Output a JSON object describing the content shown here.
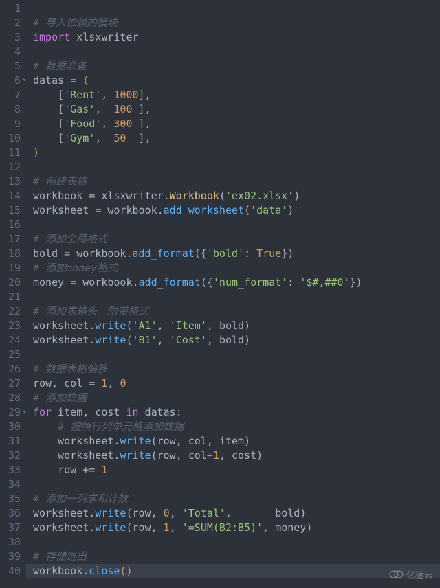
{
  "lines": [
    {
      "n": 1,
      "fold": "",
      "seg": []
    },
    {
      "n": 2,
      "fold": "",
      "seg": [
        [
          "cmt",
          "# 导入依赖的模块"
        ]
      ]
    },
    {
      "n": 3,
      "fold": "",
      "seg": [
        [
          "kw",
          "import"
        ],
        [
          "id",
          " xlsxwriter"
        ]
      ]
    },
    {
      "n": 4,
      "fold": "",
      "seg": []
    },
    {
      "n": 5,
      "fold": "",
      "seg": [
        [
          "cmt",
          "# 数据准备"
        ]
      ]
    },
    {
      "n": 6,
      "fold": "▾",
      "seg": [
        [
          "id",
          "datas "
        ],
        [
          "op",
          "= "
        ],
        [
          "par",
          "("
        ]
      ]
    },
    {
      "n": 7,
      "fold": "",
      "seg": [
        [
          "id",
          "    "
        ],
        [
          "pun",
          "["
        ],
        [
          "str",
          "'Rent'"
        ],
        [
          "pun",
          ", "
        ],
        [
          "num",
          "1000"
        ],
        [
          "pun",
          "],"
        ]
      ]
    },
    {
      "n": 8,
      "fold": "",
      "seg": [
        [
          "id",
          "    "
        ],
        [
          "pun",
          "["
        ],
        [
          "str",
          "'Gas'"
        ],
        [
          "pun",
          ",  "
        ],
        [
          "num",
          "100"
        ],
        [
          "pun",
          " ],"
        ]
      ]
    },
    {
      "n": 9,
      "fold": "",
      "seg": [
        [
          "id",
          "    "
        ],
        [
          "pun",
          "["
        ],
        [
          "str",
          "'Food'"
        ],
        [
          "pun",
          ", "
        ],
        [
          "num",
          "300"
        ],
        [
          "pun",
          " ],"
        ]
      ]
    },
    {
      "n": 10,
      "fold": "",
      "seg": [
        [
          "id",
          "    "
        ],
        [
          "pun",
          "["
        ],
        [
          "str",
          "'Gym'"
        ],
        [
          "pun",
          ",  "
        ],
        [
          "num",
          "50"
        ],
        [
          "pun",
          "  ],"
        ]
      ]
    },
    {
      "n": 11,
      "fold": "",
      "seg": [
        [
          "par",
          ")"
        ]
      ]
    },
    {
      "n": 12,
      "fold": "",
      "seg": []
    },
    {
      "n": 13,
      "fold": "",
      "seg": [
        [
          "cmt",
          "# 创建表格"
        ]
      ]
    },
    {
      "n": 14,
      "fold": "",
      "seg": [
        [
          "id",
          "workbook "
        ],
        [
          "op",
          "= "
        ],
        [
          "id",
          "xlsxwriter"
        ],
        [
          "pun",
          "."
        ],
        [
          "cls",
          "Workbook"
        ],
        [
          "pun",
          "("
        ],
        [
          "str",
          "'ex02.xlsx'"
        ],
        [
          "pun",
          ")"
        ]
      ]
    },
    {
      "n": 15,
      "fold": "",
      "seg": [
        [
          "id",
          "worksheet "
        ],
        [
          "op",
          "= "
        ],
        [
          "id",
          "workbook"
        ],
        [
          "pun",
          "."
        ],
        [
          "fn",
          "add_worksheet"
        ],
        [
          "pun",
          "("
        ],
        [
          "str",
          "'data'"
        ],
        [
          "pun",
          ")"
        ]
      ]
    },
    {
      "n": 16,
      "fold": "",
      "seg": []
    },
    {
      "n": 17,
      "fold": "",
      "seg": [
        [
          "cmt",
          "# 添加全局格式"
        ]
      ]
    },
    {
      "n": 18,
      "fold": "",
      "seg": [
        [
          "id",
          "bold "
        ],
        [
          "op",
          "= "
        ],
        [
          "id",
          "workbook"
        ],
        [
          "pun",
          "."
        ],
        [
          "fn",
          "add_format"
        ],
        [
          "pun",
          "({"
        ],
        [
          "str",
          "'bold'"
        ],
        [
          "pun",
          ": "
        ],
        [
          "const",
          "True"
        ],
        [
          "pun",
          "})"
        ]
      ]
    },
    {
      "n": 19,
      "fold": "",
      "seg": [
        [
          "cmt",
          "# 添加money格式"
        ]
      ]
    },
    {
      "n": 20,
      "fold": "",
      "seg": [
        [
          "id",
          "money "
        ],
        [
          "op",
          "= "
        ],
        [
          "id",
          "workbook"
        ],
        [
          "pun",
          "."
        ],
        [
          "fn",
          "add_format"
        ],
        [
          "pun",
          "({"
        ],
        [
          "str",
          "'num_format'"
        ],
        [
          "pun",
          ": "
        ],
        [
          "str",
          "'$#,##0'"
        ],
        [
          "pun",
          "})"
        ]
      ]
    },
    {
      "n": 21,
      "fold": "",
      "seg": []
    },
    {
      "n": 22,
      "fold": "",
      "seg": [
        [
          "cmt",
          "# 添加表格头，附带格式"
        ]
      ]
    },
    {
      "n": 23,
      "fold": "",
      "seg": [
        [
          "id",
          "worksheet"
        ],
        [
          "pun",
          "."
        ],
        [
          "fn",
          "write"
        ],
        [
          "pun",
          "("
        ],
        [
          "str",
          "'A1'"
        ],
        [
          "pun",
          ", "
        ],
        [
          "str",
          "'Item'"
        ],
        [
          "pun",
          ", "
        ],
        [
          "id",
          "bold"
        ],
        [
          "pun",
          ")"
        ]
      ]
    },
    {
      "n": 24,
      "fold": "",
      "seg": [
        [
          "id",
          "worksheet"
        ],
        [
          "pun",
          "."
        ],
        [
          "fn",
          "write"
        ],
        [
          "pun",
          "("
        ],
        [
          "str",
          "'B1'"
        ],
        [
          "pun",
          ", "
        ],
        [
          "str",
          "'Cost'"
        ],
        [
          "pun",
          ", "
        ],
        [
          "id",
          "bold"
        ],
        [
          "pun",
          ")"
        ]
      ]
    },
    {
      "n": 25,
      "fold": "",
      "seg": []
    },
    {
      "n": 26,
      "fold": "",
      "seg": [
        [
          "cmt",
          "# 数据表格偏移"
        ]
      ]
    },
    {
      "n": 27,
      "fold": "",
      "seg": [
        [
          "id",
          "row"
        ],
        [
          "pun",
          ", "
        ],
        [
          "id",
          "col "
        ],
        [
          "op",
          "= "
        ],
        [
          "num",
          "1"
        ],
        [
          "pun",
          ", "
        ],
        [
          "num",
          "0"
        ]
      ]
    },
    {
      "n": 28,
      "fold": "",
      "seg": [
        [
          "cmt",
          "# 添加数据"
        ]
      ]
    },
    {
      "n": 29,
      "fold": "▾",
      "seg": [
        [
          "kw",
          "for"
        ],
        [
          "id",
          " item"
        ],
        [
          "pun",
          ", "
        ],
        [
          "id",
          "cost "
        ],
        [
          "kw",
          "in"
        ],
        [
          "id",
          " datas"
        ],
        [
          "pun",
          ":"
        ]
      ]
    },
    {
      "n": 30,
      "fold": "",
      "seg": [
        [
          "id",
          "    "
        ],
        [
          "cmt",
          "# 按照行列单元格添加数据"
        ]
      ]
    },
    {
      "n": 31,
      "fold": "",
      "seg": [
        [
          "id",
          "    worksheet"
        ],
        [
          "pun",
          "."
        ],
        [
          "fn",
          "write"
        ],
        [
          "pun",
          "("
        ],
        [
          "id",
          "row"
        ],
        [
          "pun",
          ", "
        ],
        [
          "id",
          "col"
        ],
        [
          "pun",
          ", "
        ],
        [
          "id",
          "item"
        ],
        [
          "pun",
          ")"
        ]
      ]
    },
    {
      "n": 32,
      "fold": "",
      "seg": [
        [
          "id",
          "    worksheet"
        ],
        [
          "pun",
          "."
        ],
        [
          "fn",
          "write"
        ],
        [
          "pun",
          "("
        ],
        [
          "id",
          "row"
        ],
        [
          "pun",
          ", "
        ],
        [
          "id",
          "col"
        ],
        [
          "op",
          "+"
        ],
        [
          "num",
          "1"
        ],
        [
          "pun",
          ", "
        ],
        [
          "id",
          "cost"
        ],
        [
          "pun",
          ")"
        ]
      ]
    },
    {
      "n": 33,
      "fold": "",
      "seg": [
        [
          "id",
          "    row "
        ],
        [
          "op",
          "+= "
        ],
        [
          "num",
          "1"
        ]
      ]
    },
    {
      "n": 34,
      "fold": "",
      "seg": []
    },
    {
      "n": 35,
      "fold": "",
      "seg": [
        [
          "cmt",
          "# 添加一列求和计数"
        ]
      ]
    },
    {
      "n": 36,
      "fold": "",
      "seg": [
        [
          "id",
          "worksheet"
        ],
        [
          "pun",
          "."
        ],
        [
          "fn",
          "write"
        ],
        [
          "pun",
          "("
        ],
        [
          "id",
          "row"
        ],
        [
          "pun",
          ", "
        ],
        [
          "num",
          "0"
        ],
        [
          "pun",
          ", "
        ],
        [
          "str",
          "'Total'"
        ],
        [
          "pun",
          ",       "
        ],
        [
          "id",
          "bold"
        ],
        [
          "pun",
          ")"
        ]
      ]
    },
    {
      "n": 37,
      "fold": "",
      "seg": [
        [
          "id",
          "worksheet"
        ],
        [
          "pun",
          "."
        ],
        [
          "fn",
          "write"
        ],
        [
          "pun",
          "("
        ],
        [
          "id",
          "row"
        ],
        [
          "pun",
          ", "
        ],
        [
          "num",
          "1"
        ],
        [
          "pun",
          ", "
        ],
        [
          "str",
          "'=SUM(B2:B5)'"
        ],
        [
          "pun",
          ", "
        ],
        [
          "id",
          "money"
        ],
        [
          "pun",
          ")"
        ]
      ]
    },
    {
      "n": 38,
      "fold": "",
      "seg": []
    },
    {
      "n": 39,
      "fold": "",
      "seg": [
        [
          "cmt",
          "# 存储退出"
        ]
      ]
    },
    {
      "n": 40,
      "fold": "",
      "seg": [
        [
          "id",
          "workbook"
        ],
        [
          "pun",
          "."
        ],
        [
          "fn",
          "close"
        ],
        [
          "par",
          "()"
        ]
      ],
      "hl": true
    }
  ],
  "watermark": "亿速云"
}
